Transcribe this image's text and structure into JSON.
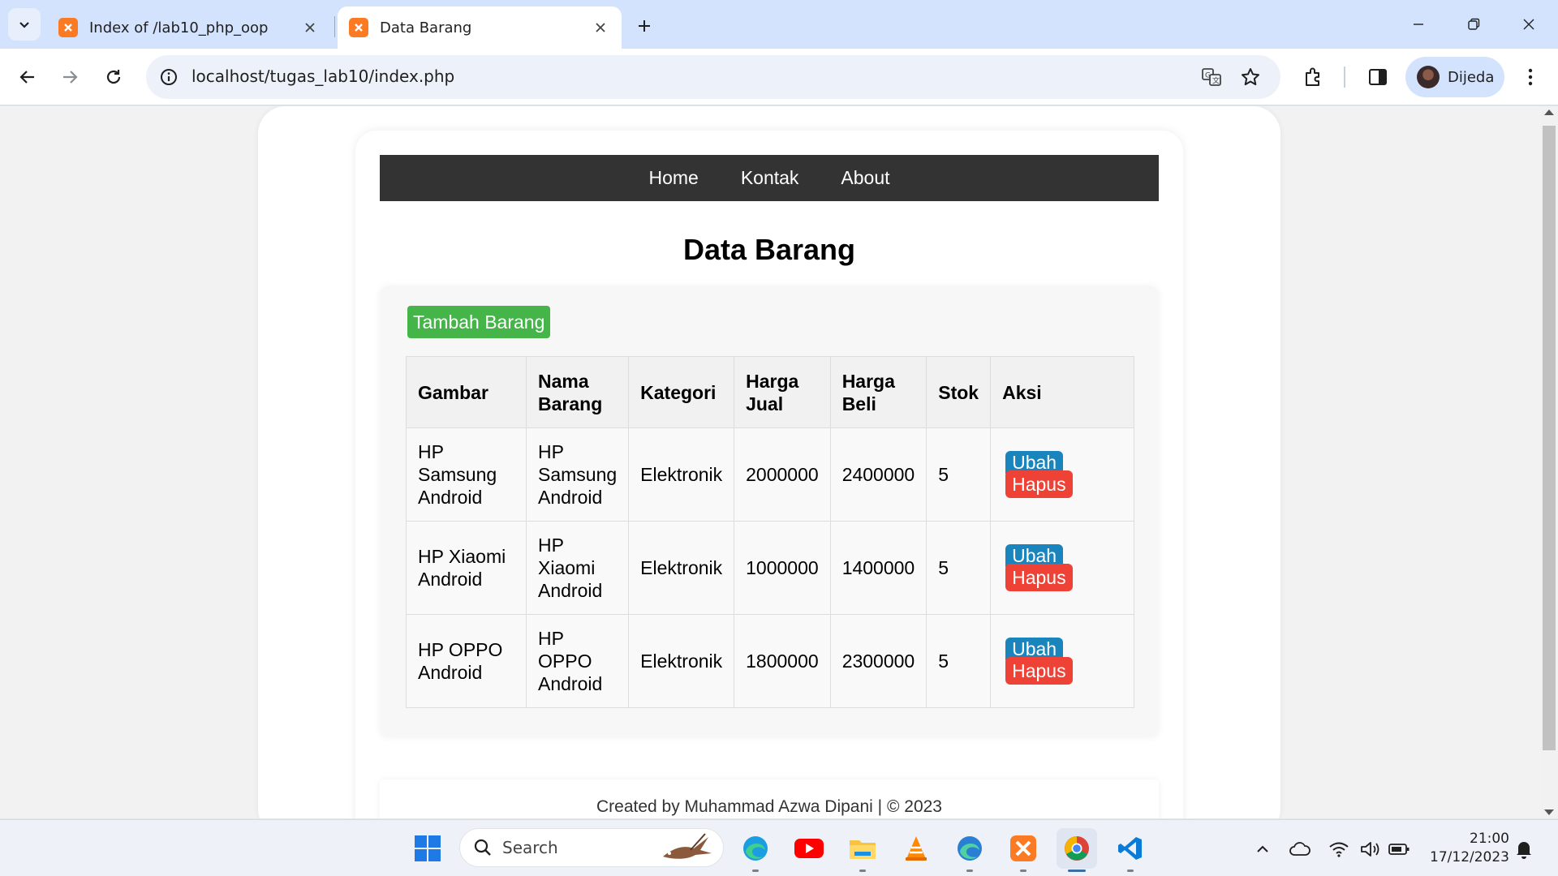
{
  "browser": {
    "tabs": [
      {
        "title": "Index of /lab10_php_oop",
        "active": false
      },
      {
        "title": "Data Barang",
        "active": true
      }
    ],
    "url": "localhost/tugas_lab10/index.php",
    "profile_name": "Dijeda",
    "accent": "#d3e3fd"
  },
  "page": {
    "nav": [
      "Home",
      "Kontak",
      "About"
    ],
    "title": "Data Barang",
    "add_button": "Tambah Barang",
    "table": {
      "headers": {
        "gambar": "Gambar",
        "nama_1": "Nama",
        "nama_2": "Barang",
        "kategori": "Kategori",
        "jual_1": "Harga",
        "jual_2": "Jual",
        "beli_1": "Harga",
        "beli_2": "Beli",
        "stok": "Stok",
        "aksi": "Aksi"
      },
      "rows": [
        {
          "img_alt": "HP Samsung Android",
          "nama": "HP Samsung Android",
          "kategori": "Elektronik",
          "harga_jual": "2000000",
          "harga_beli": "2400000",
          "stok": "5"
        },
        {
          "img_alt": "HP Xiaomi Android",
          "nama": "HP Xiaomi Android",
          "kategori": "Elektronik",
          "harga_jual": "1000000",
          "harga_beli": "1400000",
          "stok": "5"
        },
        {
          "img_alt": "HP OPPO Android",
          "nama": "HP OPPO Android",
          "kategori": "Elektronik",
          "harga_jual": "1800000",
          "harga_beli": "2300000",
          "stok": "5"
        }
      ],
      "edit_label": "Ubah",
      "delete_label": "Hapus"
    },
    "footer": "Created by Muhammad Azwa Dipani | © 2023",
    "colors": {
      "add": "#45b449",
      "edit": "#1a85bd",
      "delete": "#ee4237",
      "nav": "#333333"
    }
  },
  "taskbar": {
    "search_placeholder": "Search",
    "time": "21:00",
    "date": "17/12/2023",
    "apps": [
      "windows-start-icon",
      "edge-icon",
      "youtube-icon",
      "file-explorer-icon",
      "vlc-icon",
      "edge-beta-icon",
      "xampp-icon",
      "chrome-icon",
      "vscode-icon"
    ]
  }
}
